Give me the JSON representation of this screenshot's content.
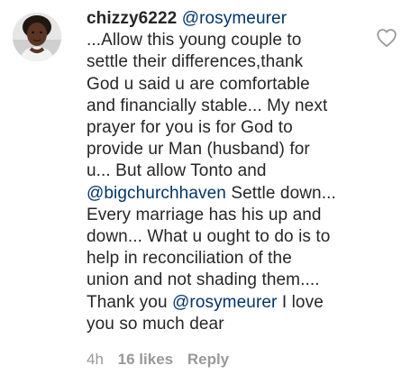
{
  "comment": {
    "username": "chizzy6222",
    "segments": [
      {
        "type": "mention",
        "text": "@rosymeurer"
      },
      {
        "type": "br"
      },
      {
        "type": "text",
        "text": "...Allow this young couple to"
      },
      {
        "type": "br"
      },
      {
        "type": "text",
        "text": "settle their differences,thank"
      },
      {
        "type": "br"
      },
      {
        "type": "text",
        "text": "God u said u are comfortable"
      },
      {
        "type": "br"
      },
      {
        "type": "text",
        "text": "and financially stable... My next"
      },
      {
        "type": "br"
      },
      {
        "type": "text",
        "text": "prayer for you is for God to"
      },
      {
        "type": "br"
      },
      {
        "type": "text",
        "text": "provide ur Man (husband) for"
      },
      {
        "type": "br"
      },
      {
        "type": "text",
        "text": "u... But allow Tonto and"
      },
      {
        "type": "br"
      },
      {
        "type": "mention",
        "text": "@bigchurchhaven"
      },
      {
        "type": "text",
        "text": " Settle down..."
      },
      {
        "type": "br"
      },
      {
        "type": "text",
        "text": "Every marriage has his up and"
      },
      {
        "type": "br"
      },
      {
        "type": "text",
        "text": "down... What u ought to do is to"
      },
      {
        "type": "br"
      },
      {
        "type": "text",
        "text": "help in reconciliation of the"
      },
      {
        "type": "br"
      },
      {
        "type": "text",
        "text": "union and not shading them...."
      },
      {
        "type": "br"
      },
      {
        "type": "text",
        "text": "Thank you "
      },
      {
        "type": "mention",
        "text": "@rosymeurer"
      },
      {
        "type": "text",
        "text": " I love"
      },
      {
        "type": "br"
      },
      {
        "type": "text",
        "text": "you so much dear"
      }
    ],
    "time": "4h",
    "likes": "16 likes",
    "reply": "Reply",
    "like_icon": "heart-outline-icon"
  },
  "colors": {
    "text": "#262626",
    "mention": "#003569",
    "meta": "#999999"
  }
}
